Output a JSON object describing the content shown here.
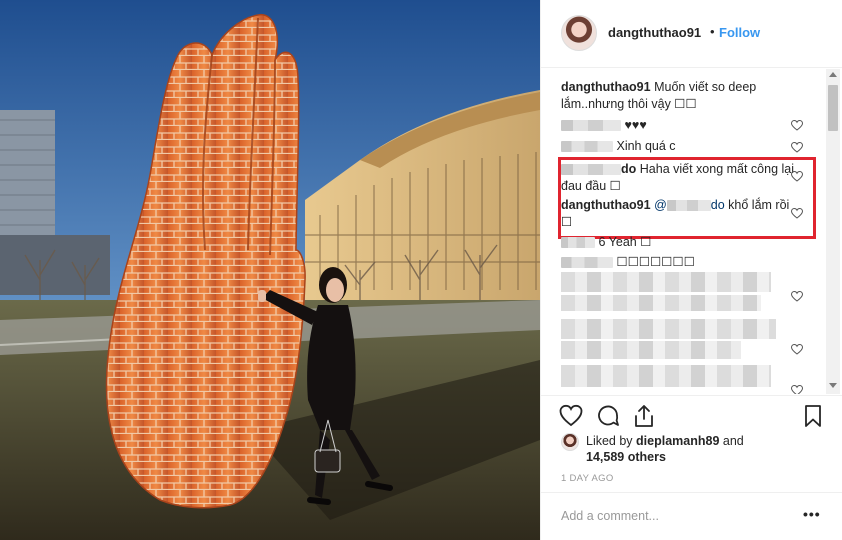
{
  "header": {
    "username": "dangthuthao91",
    "separator": "•",
    "follow_label": "Follow"
  },
  "comments": [
    {
      "username": "dangthuthao91",
      "text": "Muốn viết so deep lắm..nhưng thôi vậy ☐☐",
      "liked": false
    },
    {
      "username_blurred": true,
      "text": "♥♥♥",
      "liked": false
    },
    {
      "username_blurred": true,
      "text": "Xinh quá c",
      "liked": false
    },
    {
      "username_suffix": "do",
      "text": "Haha viết xong mất công lại đau đầu ☐",
      "liked": false
    },
    {
      "username": "dangthuthao91",
      "mention_prefix": "@",
      "mention_suffix": "do",
      "text": "khổ lắm rồi ☐",
      "liked": false
    },
    {
      "username_blurred": true,
      "text": "6 Yeah ☐",
      "liked": false
    },
    {
      "username_blurred": true,
      "text": "☐☐☐☐☐☐☐",
      "liked": false
    }
  ],
  "likes": {
    "prefix": "Liked by",
    "user": "dieplamanh89",
    "conjunction": "and",
    "others": "14,589 others"
  },
  "timestamp": "1 DAY AGO",
  "add_comment": {
    "placeholder": "Add a comment...",
    "more_label": "•••"
  },
  "icons": {
    "like": "heart-icon",
    "comment": "comment-icon",
    "share": "share-icon",
    "save": "bookmark-icon",
    "comment_like": "heart-outline-icon"
  },
  "colors": {
    "link_blue": "#3897f0",
    "highlight_red": "#e0242f",
    "text": "#262626",
    "muted": "#999999"
  }
}
